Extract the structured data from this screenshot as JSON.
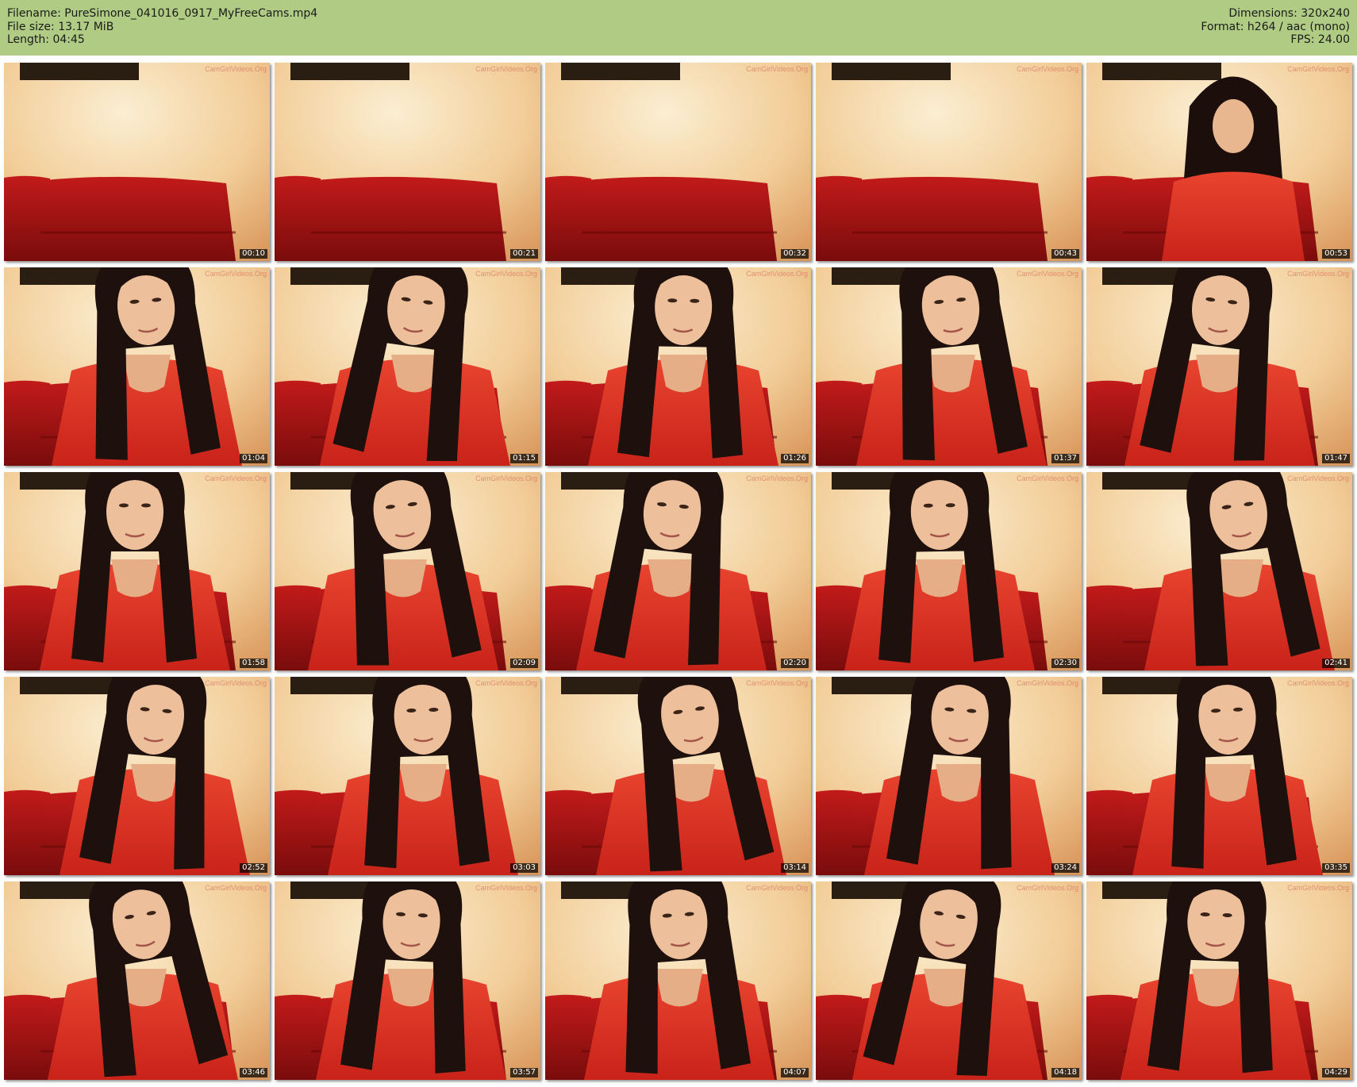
{
  "header": {
    "filename": "Filename: PureSimone_041016_0917_MyFreeCams.mp4",
    "filesize": "File size: 13.17 MiB",
    "length": "Length: 04:45",
    "dimensions": "Dimensions: 320x240",
    "format": "Format: h264 / aac (mono)",
    "fps": "FPS: 24.00"
  },
  "watermark_text": "CamGirlVideos.Org",
  "thumbnails": [
    {
      "time": "00:10",
      "scene": "empty"
    },
    {
      "time": "00:21",
      "scene": "empty"
    },
    {
      "time": "00:32",
      "scene": "empty"
    },
    {
      "time": "00:43",
      "scene": "empty"
    },
    {
      "time": "00:53",
      "scene": "far"
    },
    {
      "time": "01:04",
      "scene": "person"
    },
    {
      "time": "01:15",
      "scene": "person"
    },
    {
      "time": "01:26",
      "scene": "person"
    },
    {
      "time": "01:37",
      "scene": "person"
    },
    {
      "time": "01:47",
      "scene": "person"
    },
    {
      "time": "01:58",
      "scene": "person"
    },
    {
      "time": "02:09",
      "scene": "person"
    },
    {
      "time": "02:20",
      "scene": "person"
    },
    {
      "time": "02:30",
      "scene": "person"
    },
    {
      "time": "02:41",
      "scene": "person"
    },
    {
      "time": "02:52",
      "scene": "person"
    },
    {
      "time": "03:03",
      "scene": "person"
    },
    {
      "time": "03:14",
      "scene": "person"
    },
    {
      "time": "03:24",
      "scene": "person"
    },
    {
      "time": "03:35",
      "scene": "person"
    },
    {
      "time": "03:46",
      "scene": "person"
    },
    {
      "time": "03:57",
      "scene": "person"
    },
    {
      "time": "04:07",
      "scene": "person"
    },
    {
      "time": "04:18",
      "scene": "person"
    },
    {
      "time": "04:29",
      "scene": "person"
    }
  ]
}
